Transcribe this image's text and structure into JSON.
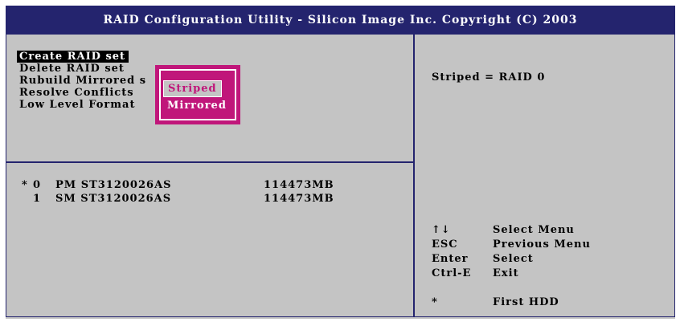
{
  "title": "RAID Configuration Utility - Silicon Image Inc. Copyright (C) 2003",
  "menu": {
    "items": [
      {
        "label": "Create RAID set",
        "selected": true
      },
      {
        "label": "Delete RAID set",
        "selected": false
      },
      {
        "label": "Rubuild Mirrored s",
        "selected": false
      },
      {
        "label": "Resolve Conflicts",
        "selected": false
      },
      {
        "label": "Low Level Format",
        "selected": false
      }
    ]
  },
  "popup": {
    "options": [
      "Striped",
      "Mirrored"
    ],
    "selected": "Striped"
  },
  "disks": [
    {
      "mark": "*",
      "index": "0",
      "model": "PM ST3120026AS",
      "size": "114473MB"
    },
    {
      "mark": "",
      "index": "1",
      "model": "SM ST3120026AS",
      "size": "114473MB"
    }
  ],
  "help": {
    "description": "Striped = RAID 0",
    "keys": [
      {
        "key": "↑↓",
        "action": "Select Menu"
      },
      {
        "key": "ESC",
        "action": "Previous Menu"
      },
      {
        "key": "Enter",
        "action": "Select"
      },
      {
        "key": "Ctrl-E",
        "action": "Exit"
      },
      {
        "key": "*",
        "action": "First HDD"
      }
    ]
  },
  "colors": {
    "title_bar": "#24246e",
    "background": "#c4c4c4",
    "popup": "#c0167a",
    "text": "#000000"
  }
}
